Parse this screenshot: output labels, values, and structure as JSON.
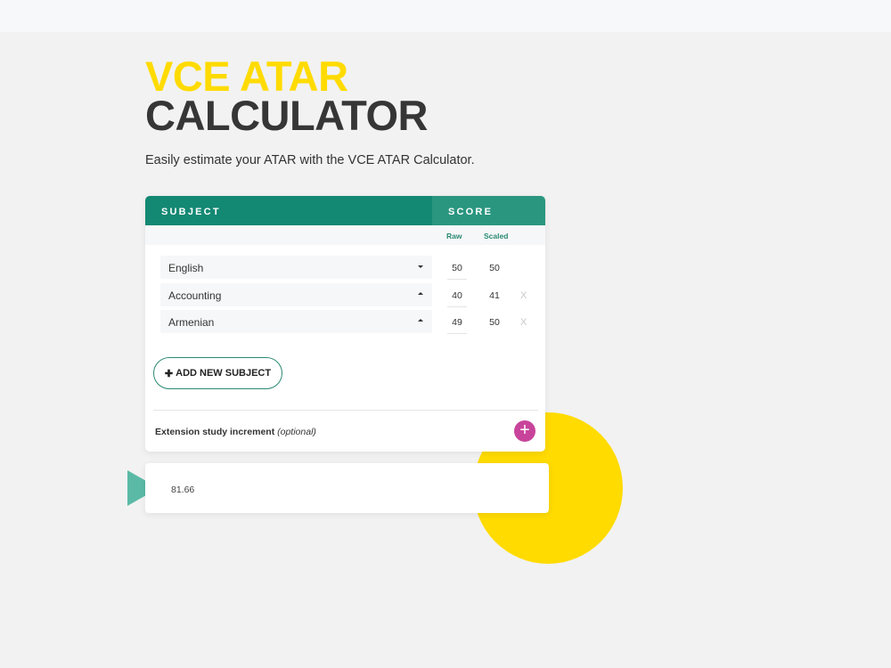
{
  "header": {
    "title_line1": "VCE ATAR",
    "title_line2": "CALCULATOR",
    "subtitle": "Easily estimate your ATAR with the VCE ATAR Calculator."
  },
  "table": {
    "subject_header": "SUBJECT",
    "score_header": "SCORE",
    "raw_label": "Raw",
    "scaled_label": "Scaled",
    "rows": [
      {
        "subject": "English",
        "raw": "50",
        "scaled": "50",
        "arrow": "down",
        "removable": false,
        "remove_label": ""
      },
      {
        "subject": "Accounting",
        "raw": "40",
        "scaled": "41",
        "arrow": "up",
        "removable": true,
        "remove_label": "X"
      },
      {
        "subject": "Armenian",
        "raw": "49",
        "scaled": "50",
        "arrow": "up",
        "removable": true,
        "remove_label": "X"
      }
    ]
  },
  "add_subject": {
    "icon": "plus-icon",
    "icon_glyph": "✚",
    "label": "ADD NEW SUBJECT"
  },
  "extension": {
    "label": "Extension study increment",
    "optional": "(optional)",
    "button_glyph": "+"
  },
  "result": {
    "value": "81.66"
  },
  "colors": {
    "brand_yellow": "#ffdb00",
    "brand_teal": "#138873",
    "accent_magenta": "#c8449b"
  }
}
